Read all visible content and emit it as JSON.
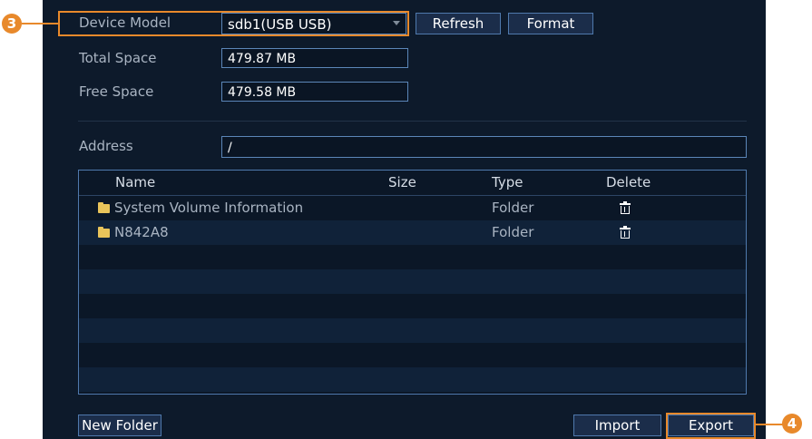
{
  "form": {
    "device_model_label": "Device Model",
    "device_model_value": "sdb1(USB USB)",
    "refresh_label": "Refresh",
    "format_label": "Format",
    "total_space_label": "Total Space",
    "total_space_value": "479.87 MB",
    "free_space_label": "Free Space",
    "free_space_value": "479.58 MB",
    "address_label": "Address",
    "address_value": "/"
  },
  "table": {
    "headers": {
      "name": "Name",
      "size": "Size",
      "type": "Type",
      "delete": "Delete"
    },
    "rows": [
      {
        "name": "System Volume Information",
        "size": "",
        "type": "Folder"
      },
      {
        "name": "N842A8",
        "size": "",
        "type": "Folder"
      }
    ]
  },
  "footer": {
    "new_folder_label": "New Folder",
    "import_label": "Import",
    "export_label": "Export"
  },
  "callouts": {
    "step3": "3",
    "step4": "4"
  },
  "colors": {
    "callout": "#e8892b",
    "panel": "#0d1a2b",
    "border": "#4f79ad",
    "folder": "#e9c45a"
  }
}
